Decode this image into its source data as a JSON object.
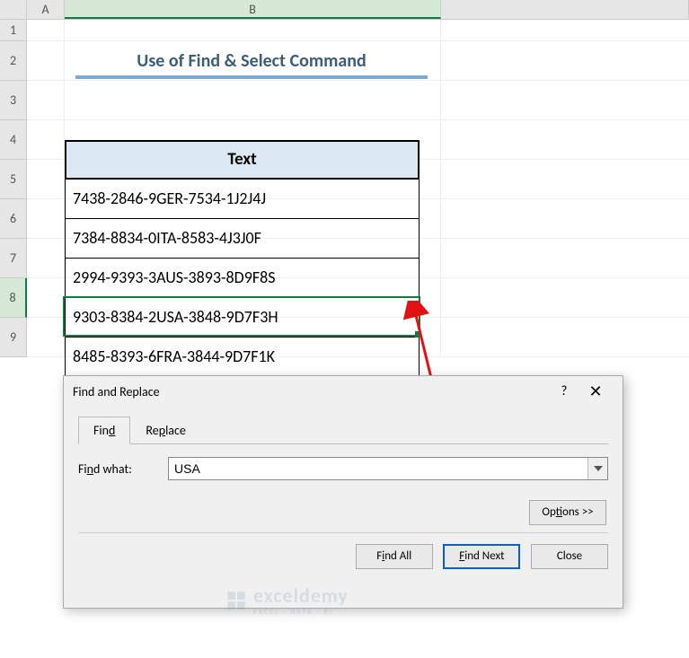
{
  "columns": {
    "a": "A",
    "b": "B"
  },
  "rows": [
    "1",
    "2",
    "3",
    "4",
    "5",
    "6",
    "7",
    "8",
    "9"
  ],
  "title": "Use of Find & Select Command",
  "table": {
    "header": "Text",
    "data": [
      "7438-2846-9GER-7534-1J2J4J",
      "7384-8834-0ITA-8583-4J3J0F",
      "2994-9393-3AUS-3893-8D9F8S",
      "9303-8384-2USA-3848-9D7F3H",
      "8485-8393-6FRA-3844-9D7F1K"
    ]
  },
  "selected_row_index": 8,
  "dialog": {
    "title": "Find and Replace",
    "help": "?",
    "close": "✕",
    "tabs": {
      "find": "Find",
      "replace": "Replace"
    },
    "find_what_label": "Find what:",
    "find_what_value": "USA",
    "options": "Options >>",
    "find_all": "Find All",
    "find_next": "Find Next",
    "close_btn": "Close"
  },
  "watermark": {
    "brand": "exceldemy",
    "sub": "EXCEL · DATA · BI"
  }
}
